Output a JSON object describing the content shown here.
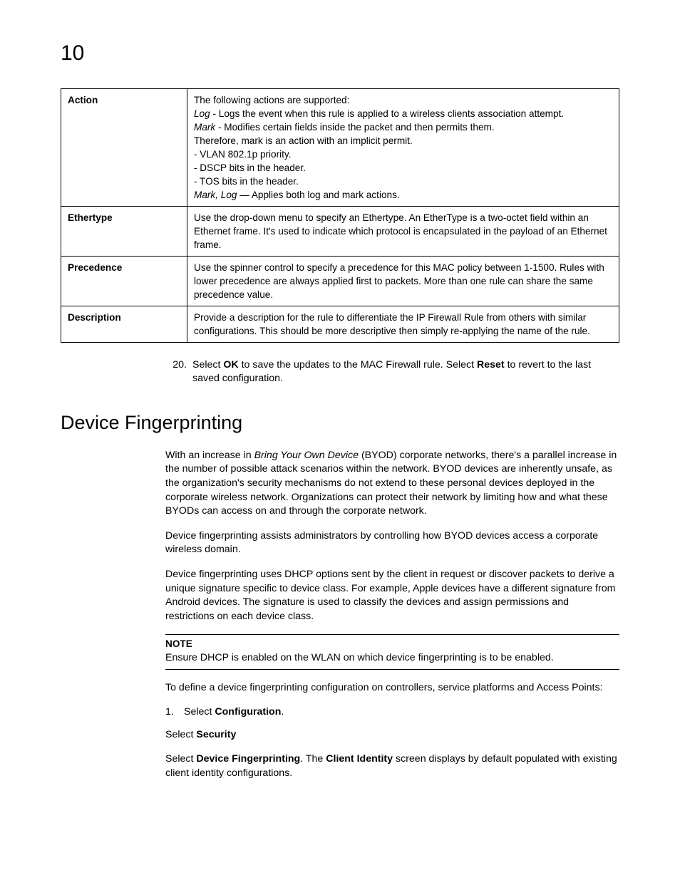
{
  "chapterNumber": "10",
  "table": {
    "rows": [
      {
        "term": "Action",
        "lines": [
          {
            "text": "The following actions are supported:"
          },
          {
            "italic": "Log",
            "text": " - Logs the event when this rule is applied to a wireless clients association attempt."
          },
          {
            "italic": "Mark",
            "text": " - Modifies certain fields inside the packet and then permits them."
          },
          {
            "text": "Therefore, mark is an action with an implicit permit."
          },
          {
            "text": "- VLAN 802.1p priority."
          },
          {
            "text": "- DSCP bits in the header."
          },
          {
            "text": "- TOS bits in the header."
          },
          {
            "italic": "Mark, Log",
            "text": " — Applies both log and mark actions."
          }
        ]
      },
      {
        "term": "Ethertype",
        "lines": [
          {
            "text": "Use the drop-down menu to specify an Ethertype. An EtherType is a two-octet field within an Ethernet frame. It's used to indicate which protocol is encapsulated in the payload of an Ethernet frame."
          }
        ]
      },
      {
        "term": "Precedence",
        "lines": [
          {
            "text": "Use the spinner control to specify a precedence for this MAC policy between 1-1500. Rules with lower precedence are always applied first to packets. More than one rule can share the same precedence value."
          }
        ]
      },
      {
        "term": "Description",
        "lines": [
          {
            "text": "Provide a description for the rule to differentiate the IP Firewall Rule from others with similar configurations. This should be more descriptive then simply re-applying the name of the rule."
          }
        ]
      }
    ]
  },
  "step20": {
    "num": "20.",
    "pre": "Select ",
    "b1": "OK",
    "mid": " to save the updates to the MAC Firewall rule. Select ",
    "b2": "Reset",
    "post": " to revert to the last saved configuration."
  },
  "sectionHeading": "Device Fingerprinting",
  "paragraphs": {
    "p1a": "With an increase in ",
    "p1i": "Bring Your Own Device",
    "p1b": " (BYOD) corporate networks, there's a parallel increase in the number of possible attack scenarios within the network. BYOD devices are inherently unsafe, as the organization's security mechanisms do not extend to these personal devices deployed in the corporate wireless network. Organizations can protect their network by limiting how and what these BYODs can access on and through the corporate network.",
    "p2": "Device fingerprinting assists administrators by controlling how BYOD devices access a corporate wireless domain.",
    "p3": "Device fingerprinting uses DHCP options sent by the client in request or discover packets to derive a unique signature specific to device class. For example, Apple devices have a different signature from Android devices. The signature is used to classify the devices and assign permissions and restrictions on each device class."
  },
  "note": {
    "label": "NOTE",
    "text": "Ensure DHCP is enabled on the WLAN on which device fingerprinting is to be enabled."
  },
  "afterNote": "To define a device fingerprinting configuration on controllers, service platforms and Access Points:",
  "steps": {
    "s1n": "1.",
    "s1a": "Select ",
    "s1b": "Configuration",
    "s1c": ".",
    "s2a": "Select ",
    "s2b": "Security",
    "s3a": "Select ",
    "s3b": "Device Fingerprinting",
    "s3c": ". The ",
    "s3d": "Client Identity",
    "s3e": " screen displays by default populated with existing client identity configurations."
  }
}
